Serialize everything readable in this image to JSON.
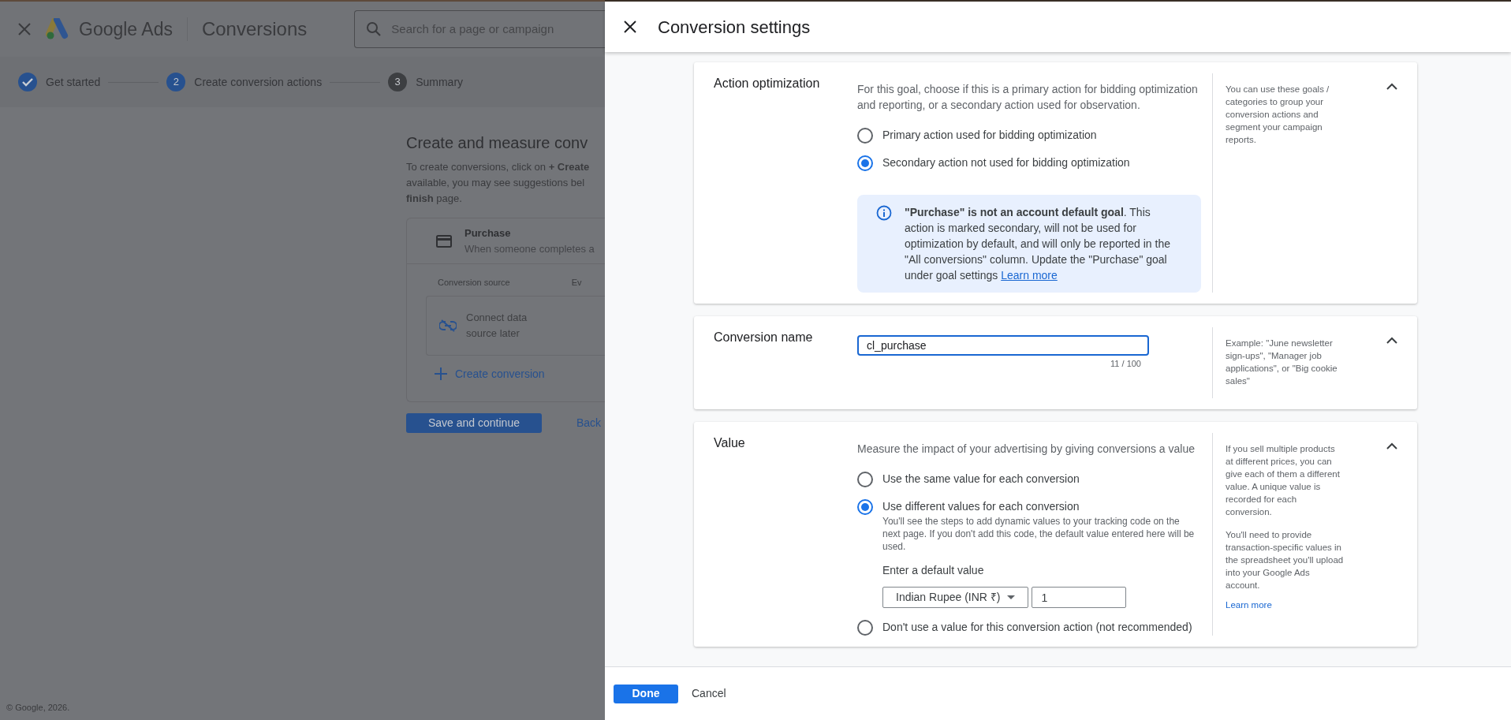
{
  "app_header": {
    "product": "Google Ads",
    "page_title": "Conversions",
    "search": {
      "placeholder": "Search for a page or campaign"
    }
  },
  "stepper": [
    {
      "label": "Get started",
      "completed": true,
      "selected": false
    },
    {
      "number": "2",
      "label": "Create conversion actions",
      "completed": false,
      "selected": true
    },
    {
      "number": "3",
      "label": "Summary",
      "completed": false,
      "selected": false
    }
  ],
  "main": {
    "title": "Create and measure conv",
    "intro_lines": [
      "To create conversions, click on **+ Create**",
      "available, you may see suggestions bel",
      "**finish** page."
    ],
    "goal_card": {
      "name": "Purchase",
      "description": "When someone completes a",
      "columns": [
        "Conversion source",
        "Ev"
      ],
      "source_lines": [
        "Connect data",
        "source later"
      ],
      "create_link": "Create conversion"
    },
    "save_button": "Save and continue",
    "back_link": "Back"
  },
  "footer": "© Google, 2026.",
  "panel": {
    "title": "Conversion settings",
    "sections": [
      {
        "kind": "radio",
        "title": "Action optimization",
        "expanded": true,
        "description": "For this goal, choose if this is a primary action for bidding optimization and reporting, or a secondary action used for observation.",
        "options": [
          {
            "label": "Primary action used for bidding optimization",
            "selected": false
          },
          {
            "label": "Secondary action not used for bidding optimization",
            "selected": true
          }
        ],
        "notice": {
          "text": "**\"Purchase\" is not an account default goal**. This action is marked secondary, will not be used for optimization by default, and will only be reported in the \"All conversions\" column. Update the \"Purchase\" goal under goal settings",
          "link": "Learn more"
        },
        "help": [
          "You can use these goals / categories to group your conversion actions and segment your campaign reports."
        ]
      },
      {
        "kind": "text",
        "title": "Conversion name",
        "expanded": true,
        "value": "cl_purchase",
        "counter": "11 / 100",
        "help": [
          "Example: \"June newsletter sign-ups\", \"Manager job applications\", or \"Big cookie sales\""
        ]
      },
      {
        "kind": "radio",
        "title": "Value",
        "expanded": true,
        "description": "Measure the impact of your advertising by giving conversions a value",
        "options": [
          {
            "label": "Use the same value for each conversion",
            "selected": false
          },
          {
            "label": "Use different values for each conversion",
            "selected": true,
            "detail": "You'll see the steps to add dynamic values to your tracking code on the next page. If you don't add this code, the default value entered here will be used.",
            "default_value": {
              "label": "Enter a default value",
              "currency": "Indian Rupee (INR ₹)",
              "amount": "1"
            }
          },
          {
            "label": "Don't use a value for this conversion action (not recommended)",
            "selected": false
          }
        ],
        "help": [
          "If you sell multiple products at different prices, you can give each of them a different value. A unique value is recorded for each conversion.",
          "You'll need to provide transaction-specific values in the spreadsheet you'll upload into your Google Ads account."
        ],
        "help_link": "Learn more"
      }
    ],
    "done_button": "Done",
    "cancel_button": "Cancel"
  }
}
